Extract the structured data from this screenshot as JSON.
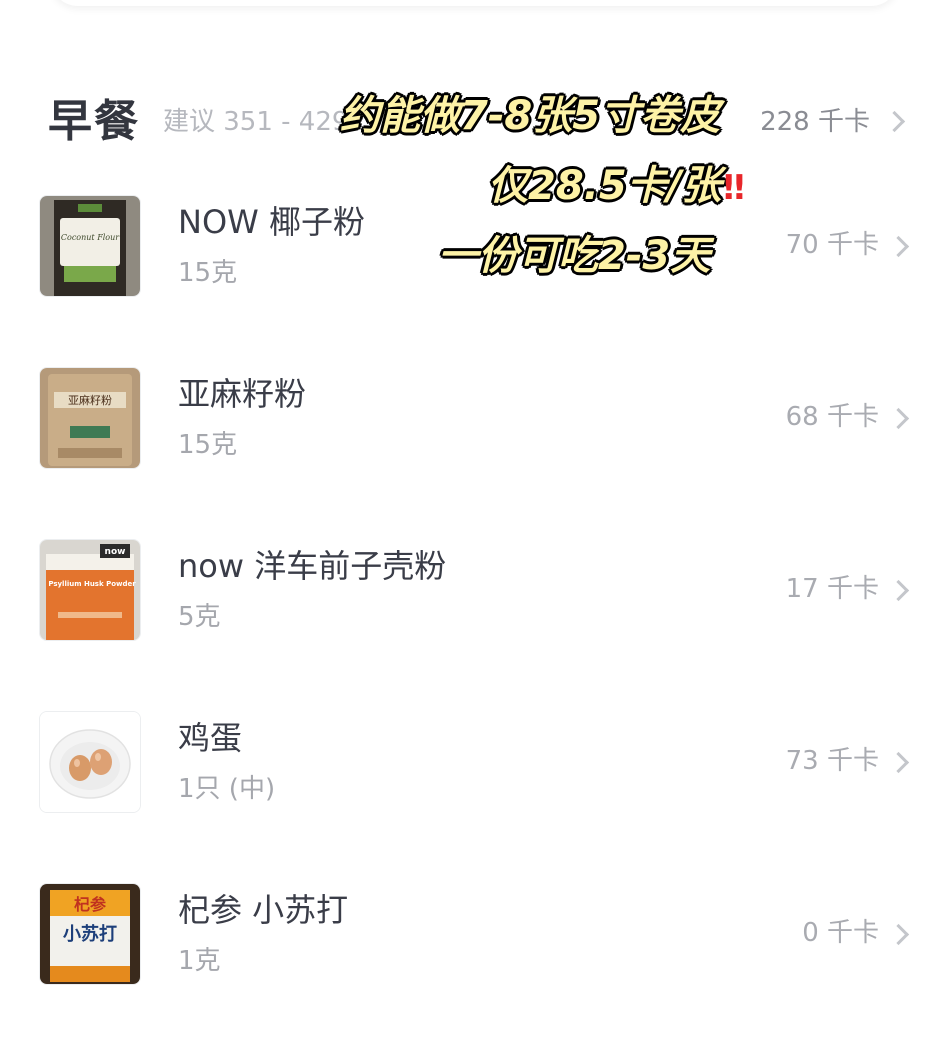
{
  "meal": {
    "title": "早餐",
    "suggest": "建议 351 - 429",
    "total": "228 千卡"
  },
  "items": [
    {
      "name": "NOW 椰子粉",
      "amount": "15克",
      "calories": "70 千卡",
      "thumb_icon": "coconut-flour-bag-icon",
      "thumb_label": "Coconut Flour"
    },
    {
      "name": "亚麻籽粉",
      "amount": "15克",
      "calories": "68 千卡",
      "thumb_icon": "flaxseed-powder-bag-icon",
      "thumb_label": "亚麻籽粉"
    },
    {
      "name": "now 洋车前子壳粉",
      "amount": "5克",
      "calories": "17 千卡",
      "thumb_icon": "psyllium-husk-bag-icon",
      "thumb_label": "Psyllium Husk Powder"
    },
    {
      "name": "鸡蛋",
      "amount": "1只 (中)",
      "calories": "73 千卡",
      "thumb_icon": "eggs-plate-icon"
    },
    {
      "name": "杞参 小苏打",
      "amount": "1克",
      "calories": "0 千卡",
      "thumb_icon": "baking-soda-bag-icon",
      "thumb_label": "小苏打"
    }
  ],
  "overlay": {
    "line1": "约能做7-8张5寸卷皮",
    "line2": "仅28.5卡/张",
    "line2_mark": "‼",
    "line3": "一份可吃2-3天"
  },
  "colors": {
    "overlay_text": "#fdf2a6",
    "overlay_outline": "#000000",
    "mark_red": "#e8262a"
  }
}
